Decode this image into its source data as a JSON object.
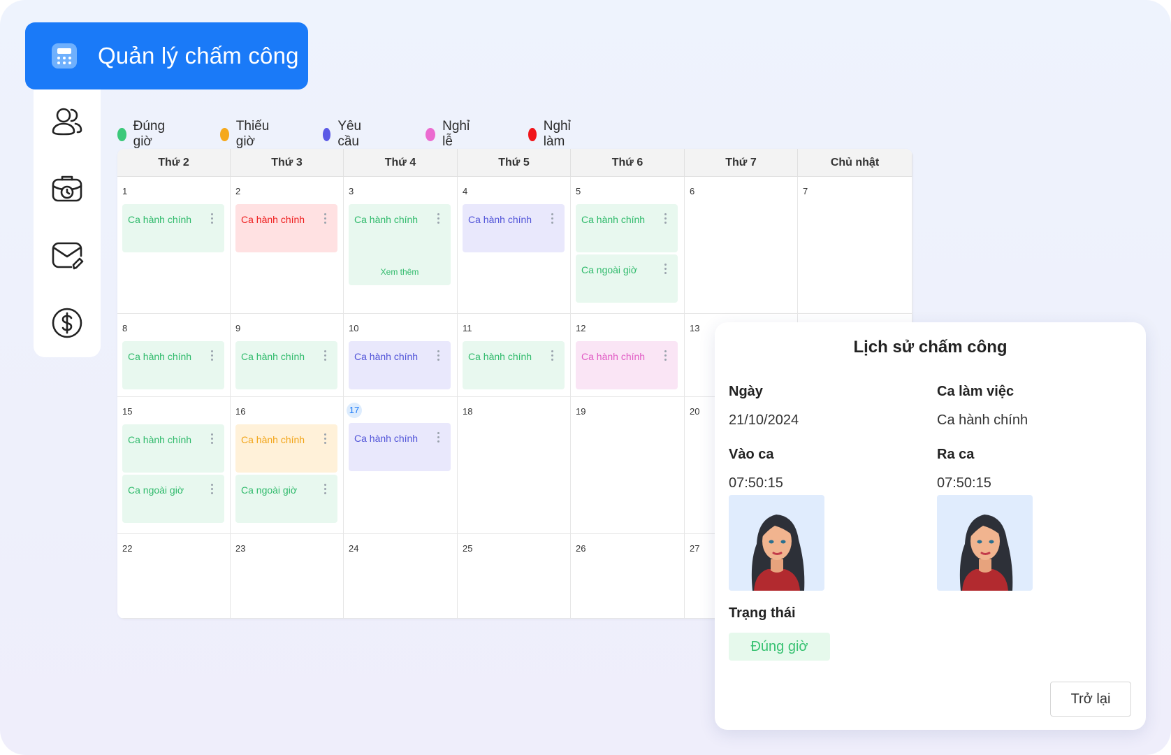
{
  "header": {
    "title": "Quản lý chấm công",
    "icon": "calculator-icon"
  },
  "sidebar": {
    "items": [
      {
        "icon": "users-icon"
      },
      {
        "icon": "briefcase-clock-icon"
      },
      {
        "icon": "mail-edit-icon"
      },
      {
        "icon": "dollar-icon"
      }
    ]
  },
  "legend": [
    {
      "label": "Đúng giờ",
      "color": "#3cc97a"
    },
    {
      "label": "Thiếu giờ",
      "color": "#f5a91c"
    },
    {
      "label": "Yêu cầu",
      "color": "#5b5ae6"
    },
    {
      "label": "Nghỉ lễ",
      "color": "#eb6bd0"
    },
    {
      "label": "Nghỉ làm",
      "color": "#f0151a"
    }
  ],
  "calendar": {
    "weekdays": [
      "Thứ 2",
      "Thứ 3",
      "Thứ 4",
      "Thứ 5",
      "Thứ 6",
      "Thứ 7",
      "Chủ nhật"
    ],
    "weeks": [
      [
        "1",
        "2",
        "3",
        "4",
        "5",
        "6",
        "7"
      ],
      [
        "8",
        "9",
        "10",
        "11",
        "12",
        "13",
        ""
      ],
      [
        "15",
        "16",
        "17",
        "18",
        "19",
        "20",
        ""
      ],
      [
        "22",
        "23",
        "24",
        "25",
        "26",
        "27",
        ""
      ]
    ],
    "today": "17",
    "shifts": [
      {
        "week": 0,
        "day": 0,
        "label": "Ca hành chính",
        "status": "green"
      },
      {
        "week": 0,
        "day": 1,
        "label": "Ca hành chính",
        "status": "red"
      },
      {
        "week": 0,
        "day": 2,
        "label": "Ca hành chính",
        "status": "green",
        "more": "Xem thêm"
      },
      {
        "week": 0,
        "day": 3,
        "label": "Ca hành chính",
        "status": "blue"
      },
      {
        "week": 0,
        "day": 4,
        "label": "Ca hành chính",
        "status": "green"
      },
      {
        "week": 0,
        "day": 4,
        "label": "Ca ngoài giờ",
        "status": "green",
        "slot": 1
      },
      {
        "week": 1,
        "day": 0,
        "label": "Ca hành chính",
        "status": "green"
      },
      {
        "week": 1,
        "day": 1,
        "label": "Ca hành chính",
        "status": "green"
      },
      {
        "week": 1,
        "day": 2,
        "label": "Ca hành chính",
        "status": "blue"
      },
      {
        "week": 1,
        "day": 3,
        "label": "Ca hành chính",
        "status": "green"
      },
      {
        "week": 1,
        "day": 4,
        "label": "Ca hành chính",
        "status": "pink"
      },
      {
        "week": 2,
        "day": 0,
        "label": "Ca hành chính",
        "status": "green"
      },
      {
        "week": 2,
        "day": 0,
        "label": "Ca ngoài giờ",
        "status": "green",
        "slot": 1
      },
      {
        "week": 2,
        "day": 1,
        "label": "Ca hành chính",
        "status": "orange"
      },
      {
        "week": 2,
        "day": 1,
        "label": "Ca ngoài giờ",
        "status": "green",
        "slot": 1
      },
      {
        "week": 2,
        "day": 2,
        "label": "Ca hành chính",
        "status": "blue"
      }
    ]
  },
  "history": {
    "title": "Lịch sử chấm công",
    "date_label": "Ngày",
    "date_value": "21/10/2024",
    "shift_label": "Ca làm việc",
    "shift_value": "Ca hành chính",
    "checkin_label": "Vào ca",
    "checkin_value": "07:50:15",
    "checkout_label": "Ra ca",
    "checkout_value": "07:50:15",
    "status_label": "Trạng thái",
    "status_value": "Đúng giờ",
    "back_label": "Trở lại"
  }
}
